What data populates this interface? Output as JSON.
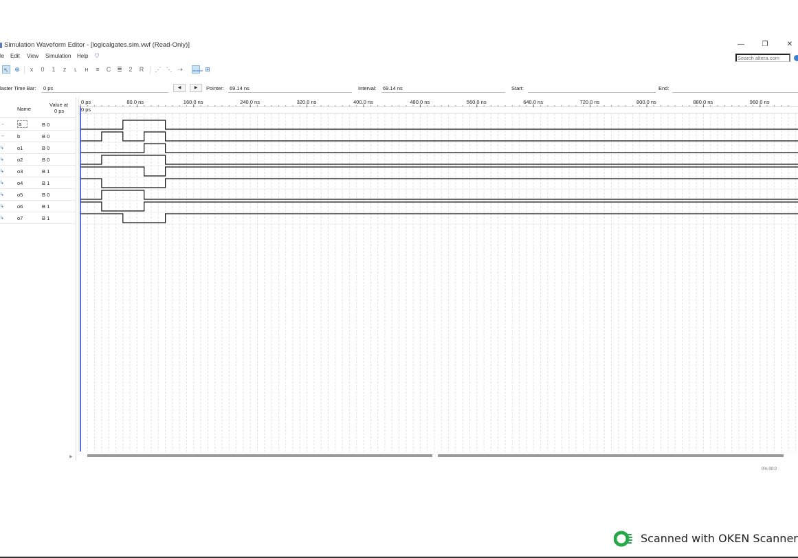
{
  "window": {
    "title": "Simulation Waveform Editor - [logicalgates.sim.vwf (Read-Only)]",
    "minimize": "—",
    "restore": "❐",
    "close": "✕"
  },
  "menu": [
    "le",
    "Edit",
    "View",
    "Simulation",
    "Help"
  ],
  "search": {
    "placeholder": "Search altera.com"
  },
  "timebar": {
    "master_label": "laster Time Bar:",
    "master_value": "0 ps",
    "pointer_label": "Pointer:",
    "pointer_value": "69.14 ns",
    "interval_label": "Interval:",
    "interval_value": "69.14 ns",
    "start_label": "Start:",
    "start_value": "",
    "end_label": "End:",
    "end_value": ""
  },
  "columns": {
    "name": "Name",
    "value_line1": "Value at",
    "value_line2": "0 ps"
  },
  "signals": [
    {
      "name": "a",
      "value": "B 0",
      "kind": "input"
    },
    {
      "name": "b",
      "value": "B 0",
      "kind": "input"
    },
    {
      "name": "o1",
      "value": "B 0",
      "kind": "output"
    },
    {
      "name": "o2",
      "value": "B 0",
      "kind": "output"
    },
    {
      "name": "o3",
      "value": "B 1",
      "kind": "output"
    },
    {
      "name": "o4",
      "value": "B 1",
      "kind": "output"
    },
    {
      "name": "o5",
      "value": "B 0",
      "kind": "output"
    },
    {
      "name": "o6",
      "value": "B 1",
      "kind": "output"
    },
    {
      "name": "o7",
      "value": "B 1",
      "kind": "output"
    }
  ],
  "time_axis": {
    "ticks": [
      "0 ps",
      "80.0 ns",
      "160.0 ns",
      "240.0 ns",
      "320.0 ns",
      "400.0 ns",
      "480.0 ns",
      "560.0 ns",
      "640.0 ns",
      "720.0 ns",
      "800.0 ns",
      "880.0 ns",
      "960.0 ns"
    ],
    "cursor_label": "0 ps",
    "range_ns": [
      0,
      1000
    ]
  },
  "waveforms": {
    "a": [
      [
        0,
        0
      ],
      [
        60,
        1
      ],
      [
        120,
        0
      ]
    ],
    "b": [
      [
        0,
        0
      ],
      [
        30,
        1
      ],
      [
        60,
        0
      ],
      [
        90,
        1
      ],
      [
        120,
        0
      ]
    ],
    "o1": [
      [
        0,
        0
      ],
      [
        90,
        1
      ],
      [
        120,
        0
      ]
    ],
    "o2": [
      [
        0,
        0
      ],
      [
        30,
        1
      ],
      [
        120,
        0
      ]
    ],
    "o3": [
      [
        0,
        1
      ],
      [
        90,
        0
      ],
      [
        120,
        1
      ]
    ],
    "o4": [
      [
        0,
        1
      ],
      [
        30,
        0
      ],
      [
        120,
        1
      ]
    ],
    "o5": [
      [
        0,
        0
      ],
      [
        30,
        1
      ],
      [
        90,
        0
      ]
    ],
    "o6": [
      [
        0,
        1
      ],
      [
        30,
        0
      ],
      [
        90,
        1
      ]
    ],
    "o7": [
      [
        0,
        1
      ],
      [
        60,
        0
      ],
      [
        120,
        1
      ]
    ]
  },
  "status": "0%    00:0",
  "watermark": "Scanned with OKEN Scanner",
  "colors": {
    "cursor": "#2a3fd6",
    "wave": "#111111",
    "grid": "#e2e2e2",
    "accent": "#2f6db5",
    "logo": "#27a84a"
  },
  "icons": [
    "window-icon",
    "selection-tool-icon",
    "zoom-tool-icon",
    "waveform-value-icons",
    "chart-icon",
    "snap-icon",
    "input-pin-icon",
    "output-pin-icon",
    "scroll-left-icon"
  ]
}
